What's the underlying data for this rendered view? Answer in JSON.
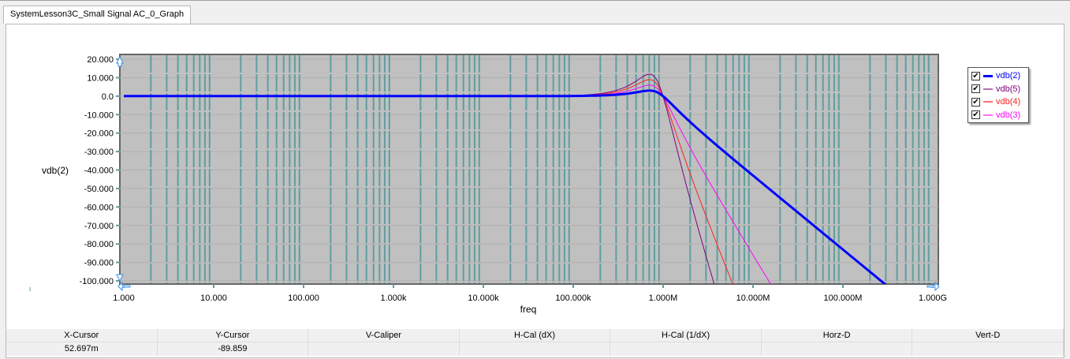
{
  "tab": {
    "title": "SystemLesson3C_Small Signal AC_0_Graph"
  },
  "chart_data": {
    "type": "line",
    "xlabel": "freq",
    "ylabel": "vdb(2)",
    "xscale": "log",
    "xlim": [
      1,
      1000000000
    ],
    "ylim": [
      -100,
      20
    ],
    "x_ticks": [
      1,
      10,
      100,
      1000,
      10000,
      100000,
      1000000,
      10000000,
      100000000,
      1000000000
    ],
    "x_tick_labels": [
      "1.000",
      "10.000",
      "100.000",
      "1.000k",
      "10.000k",
      "100.000k",
      "1.000M",
      "10.000M",
      "100.000M",
      "1.000G"
    ],
    "y_ticks": [
      20,
      10,
      0,
      -10,
      -20,
      -30,
      -40,
      -50,
      -60,
      -70,
      -80,
      -90,
      -100
    ],
    "y_tick_labels": [
      "20.000",
      "10.000",
      "0.0",
      "-10.000",
      "-20.000",
      "-30.000",
      "-40.000",
      "-50.000",
      "-60.000",
      "-70.000",
      "-80.000",
      "-90.000",
      "-100.000"
    ],
    "grid": true,
    "legend": "right",
    "model": "low-pass cascade of 2nd-order sections, f0 = 0.84 MHz, Q = 1.3; peak near 0.72 MHz",
    "series": [
      {
        "name": "vdb(2)",
        "color": "#0000ff",
        "order": 1,
        "f0": 840000,
        "Q": 1.3,
        "peak_db": 3,
        "width": 3
      },
      {
        "name": "vdb(5)",
        "color": "#800080",
        "order": 4,
        "f0": 840000,
        "Q": 1.3,
        "peak_db": 12,
        "width": 1
      },
      {
        "name": "vdb(4)",
        "color": "#ff2020",
        "order": 3,
        "f0": 840000,
        "Q": 1.3,
        "peak_db": 9,
        "width": 1
      },
      {
        "name": "vdb(3)",
        "color": "#ff00ff",
        "order": 2,
        "f0": 840000,
        "Q": 1.3,
        "peak_db": 6,
        "width": 1
      }
    ]
  },
  "legend_colors": [
    "#0000ff",
    "#b070b0",
    "#ff7070",
    "#ff70ff"
  ],
  "cursor_table": {
    "headers": [
      "X-Cursor",
      "Y-Cursor",
      "V-Caliper",
      "H-Cal (dX)",
      "H-Cal (1/dX)",
      "Horz-D",
      "Vert-D"
    ],
    "values": [
      "52.697m",
      "-89.859",
      "",
      "",
      "",
      "",
      ""
    ]
  }
}
